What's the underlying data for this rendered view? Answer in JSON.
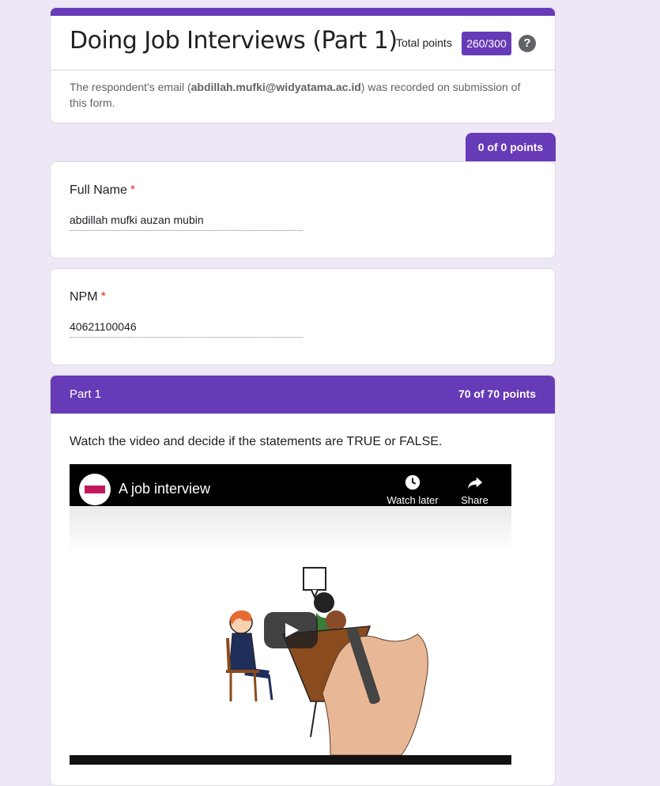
{
  "header": {
    "title": "Doing Job Interviews (Part 1)",
    "total_points_label": "Total points",
    "total_points_value": "260/300",
    "help_icon": "?",
    "email_note_prefix": "The respondent's email (",
    "email": "abdillah.mufki@widyatama.ac.id",
    "email_note_suffix": ") was recorded on submission of this form."
  },
  "section0": {
    "points": "0 of 0 points"
  },
  "questions": [
    {
      "label": "Full Name",
      "required": "*",
      "answer": "abdillah mufki auzan mubin"
    },
    {
      "label": "NPM",
      "required": "*",
      "answer": "40621100046"
    }
  ],
  "section1": {
    "title": "Part 1",
    "points": "70 of 70 points",
    "description": "Watch the video and decide if the statements are TRUE or FALSE.",
    "video": {
      "title": "A job interview",
      "watch_later": "Watch later",
      "share": "Share",
      "bubble_text": "?"
    }
  },
  "colors": {
    "accent": "#673ab7",
    "background": "#ede7f6",
    "required": "#d93025"
  }
}
